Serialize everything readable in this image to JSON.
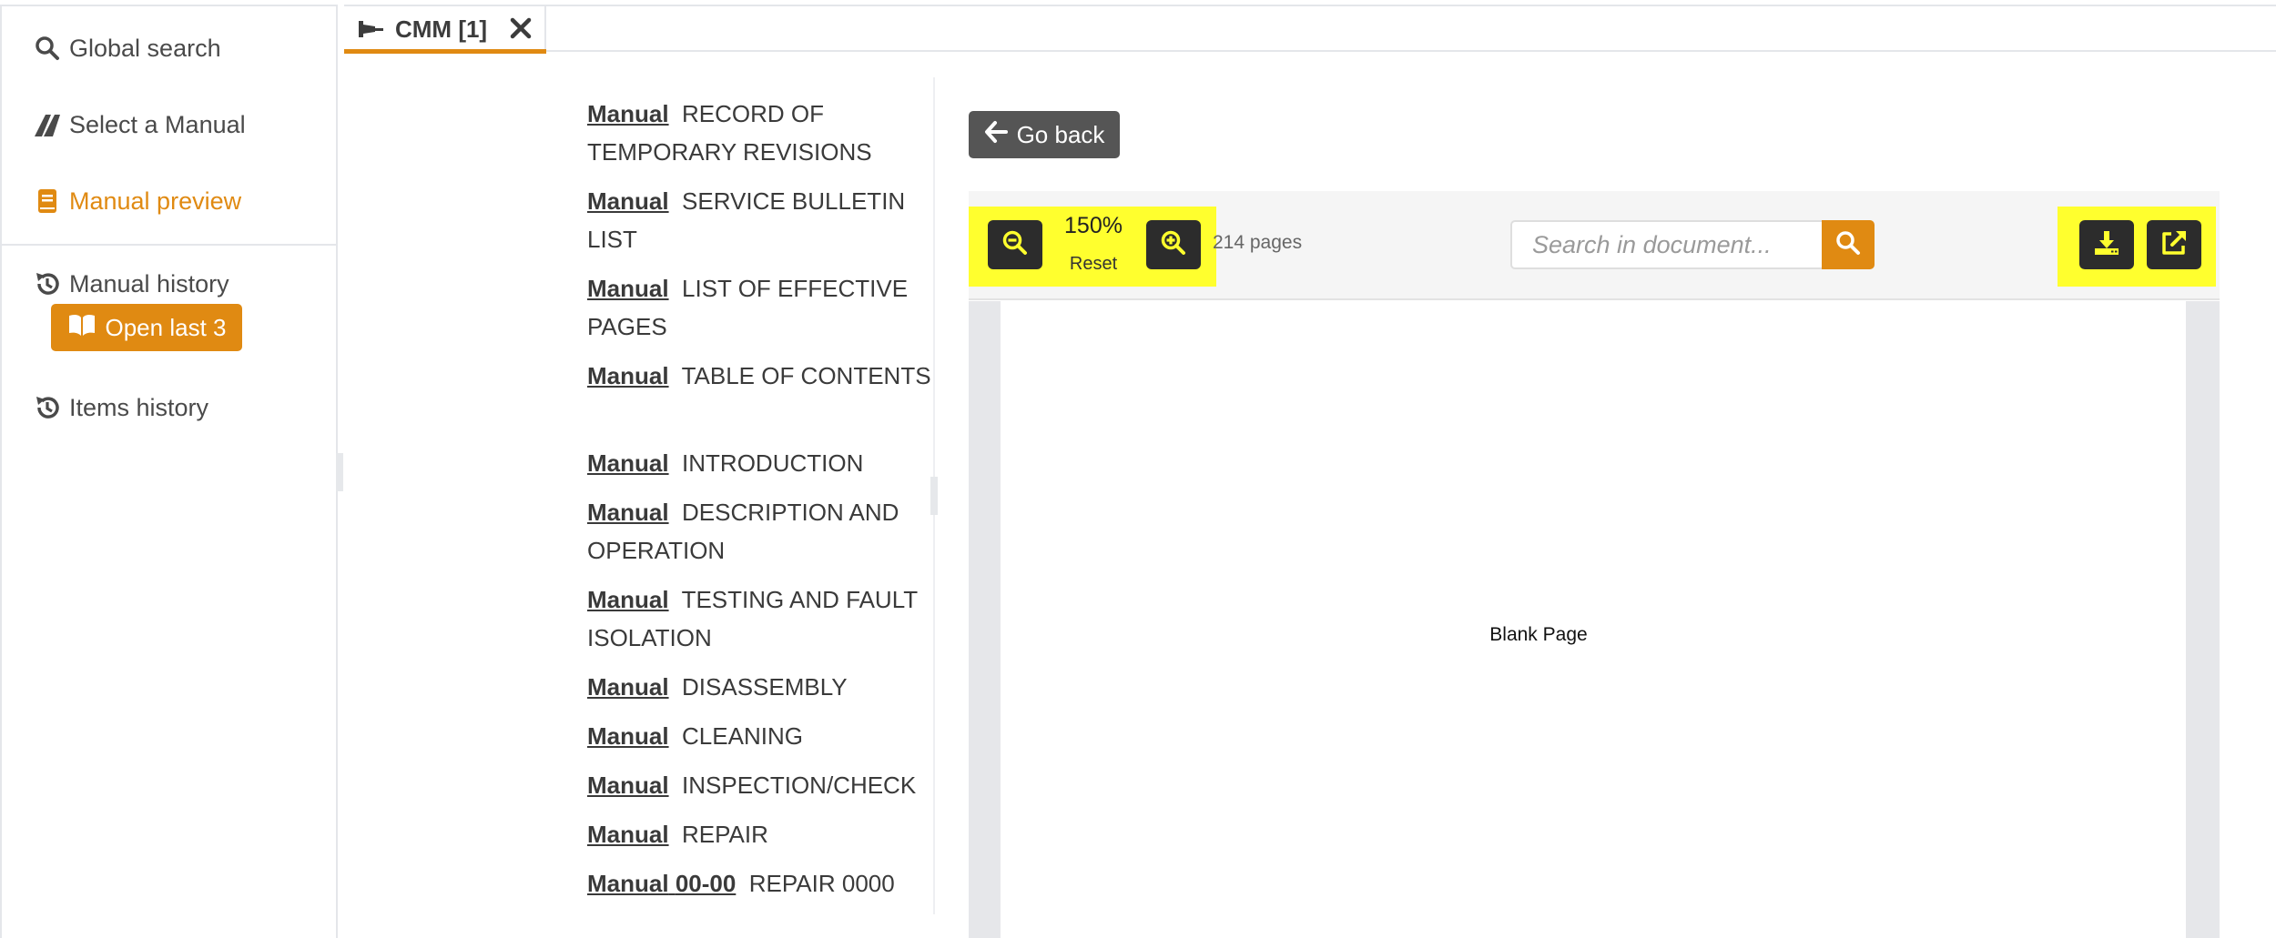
{
  "sidebar": {
    "global_search": "Global search",
    "select_manual": "Select a Manual",
    "manual_preview": "Manual preview",
    "manual_history": "Manual history",
    "open_last": "Open last 3",
    "items_history": "Items history",
    "icons": {
      "global_search": "search-icon",
      "select_manual": "plane-icon",
      "manual_preview": "book-icon",
      "manual_history": "history-icon",
      "open_last": "open-book-icon",
      "items_history": "history-icon"
    },
    "active_color": "#e08a12"
  },
  "tabs": [
    {
      "label": "CMM [1]",
      "pinned": true,
      "closable": true,
      "active": true
    }
  ],
  "toc": {
    "items": [
      {
        "keyword": "Manual",
        "code": "",
        "title": "RECORD OF TEMPORARY REVISIONS"
      },
      {
        "keyword": "Manual",
        "code": "",
        "title": "SERVICE BULLETIN LIST"
      },
      {
        "keyword": "Manual",
        "code": "",
        "title": "LIST OF EFFECTIVE PAGES"
      },
      {
        "keyword": "Manual",
        "code": "",
        "title": "TABLE OF CONTENTS"
      },
      {
        "keyword": "Manual",
        "code": "",
        "title": "INTRODUCTION"
      },
      {
        "keyword": "Manual",
        "code": "",
        "title": "DESCRIPTION AND OPERATION"
      },
      {
        "keyword": "Manual",
        "code": "",
        "title": "TESTING AND FAULT ISOLATION"
      },
      {
        "keyword": "Manual",
        "code": "",
        "title": "DISASSEMBLY"
      },
      {
        "keyword": "Manual",
        "code": "",
        "title": "CLEANING"
      },
      {
        "keyword": "Manual",
        "code": "",
        "title": "INSPECTION/CHECK"
      },
      {
        "keyword": "Manual",
        "code": "",
        "title": "REPAIR"
      },
      {
        "keyword": "Manual",
        "code": "00-00",
        "title": "REPAIR 0000"
      }
    ]
  },
  "viewer": {
    "go_back": "Go back",
    "zoom_value": "150%",
    "zoom_reset": "Reset",
    "page_count": "214 pages",
    "search_placeholder": "Search in document...",
    "search_value": "",
    "page_text": "Blank Page",
    "highlight_color": "#ffff2e"
  }
}
